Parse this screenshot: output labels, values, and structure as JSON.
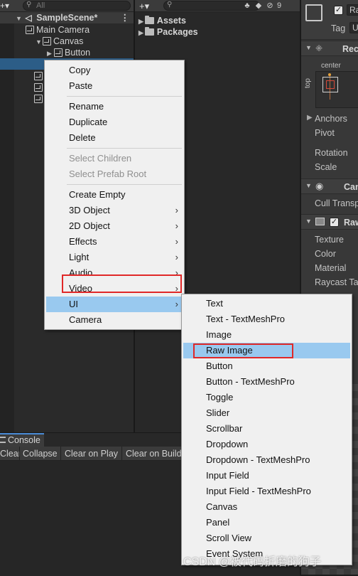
{
  "hierarchy": {
    "search_placeholder": "All",
    "scene_name": "SampleScene*",
    "items": [
      "Main Camera",
      "Canvas",
      "Button"
    ]
  },
  "project": {
    "search_placeholder": "",
    "hidden_count": "9",
    "folders": [
      "Assets",
      "Packages"
    ]
  },
  "inspector": {
    "tag_label": "Tag",
    "tag_value": "U",
    "name_prefix": "Ra",
    "rect_header": "Rec",
    "anchor_preset_h": "center",
    "anchor_preset_v": "top",
    "fields": [
      "Anchors",
      "Pivot",
      "Rotation",
      "Scale"
    ],
    "canvas_renderer_header": "Can",
    "cull_label": "Cull Transp",
    "raw_image_header": "Raw",
    "raw_fields": [
      "Texture",
      "Color",
      "Material",
      "Raycast Ta"
    ]
  },
  "console": {
    "tab_label": "Console",
    "buttons": [
      "Clear",
      "Collapse",
      "Clear on Play",
      "Clear on Build"
    ]
  },
  "context_menu": {
    "groups": [
      [
        {
          "label": "Copy"
        },
        {
          "label": "Paste"
        }
      ],
      [
        {
          "label": "Rename"
        },
        {
          "label": "Duplicate"
        },
        {
          "label": "Delete"
        }
      ],
      [
        {
          "label": "Select Children",
          "disabled": true
        },
        {
          "label": "Select Prefab Root",
          "disabled": true
        }
      ],
      [
        {
          "label": "Create Empty"
        },
        {
          "label": "3D Object",
          "submenu": true
        },
        {
          "label": "2D Object",
          "submenu": true
        },
        {
          "label": "Effects",
          "submenu": true
        },
        {
          "label": "Light",
          "submenu": true
        },
        {
          "label": "Audio",
          "submenu": true
        },
        {
          "label": "Video",
          "submenu": true
        },
        {
          "label": "UI",
          "submenu": true,
          "highlighted": true
        },
        {
          "label": "Camera"
        }
      ]
    ]
  },
  "ui_submenu": {
    "items": [
      "Text",
      "Text - TextMeshPro",
      "Image",
      "Raw Image",
      "Button",
      "Button - TextMeshPro",
      "Toggle",
      "Slider",
      "Scrollbar",
      "Dropdown",
      "Dropdown - TextMeshPro",
      "Input Field",
      "Input Field - TextMeshPro",
      "Canvas",
      "Panel",
      "Scroll View",
      "Event System"
    ],
    "highlighted": "Raw Image"
  },
  "watermark": "CSDN @被代码折磨的狗子",
  "colors": {
    "menu_highlight": "#99c9ef",
    "annotation_red": "#e02828",
    "selection_blue": "#2c5d87"
  }
}
